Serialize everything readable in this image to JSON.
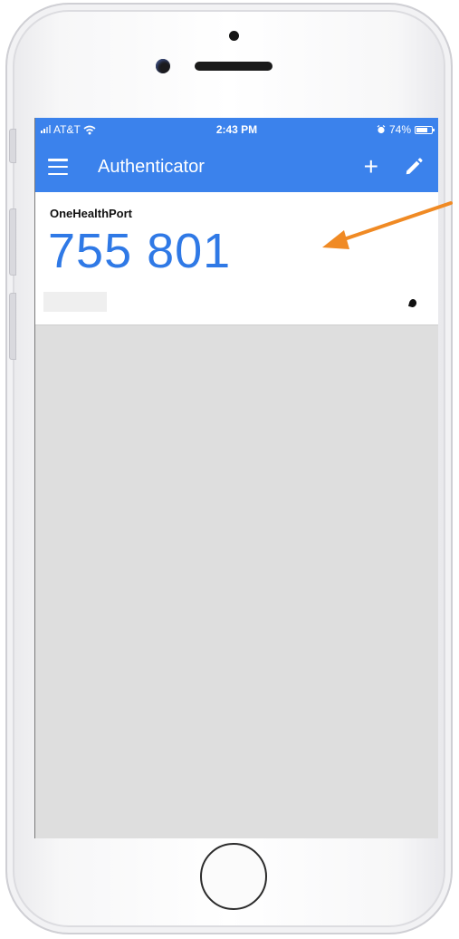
{
  "status_bar": {
    "carrier": "AT&T",
    "time": "2:43 PM",
    "battery": "74%",
    "battery_level": 0.74
  },
  "app_bar": {
    "title": "Authenticator"
  },
  "account": {
    "name": "OneHealthPort",
    "code": "755 801"
  },
  "colors": {
    "app_bar": "#3b82ec",
    "code": "#2f79e6",
    "annotation_arrow": "#f08a24"
  },
  "icons": [
    "menu-icon",
    "add-icon",
    "edit-pencil-icon",
    "wifi-icon",
    "alarm-icon",
    "battery-icon",
    "countdown-timer-icon"
  ]
}
